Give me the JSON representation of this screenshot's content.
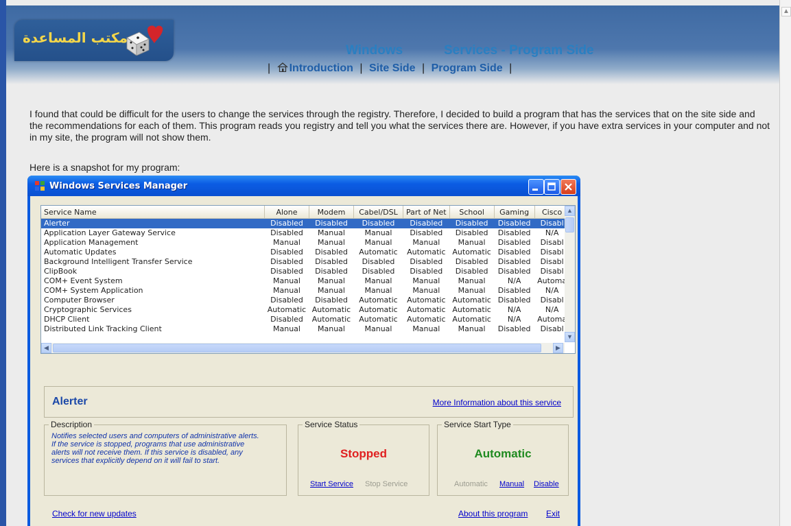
{
  "header": {
    "title_part1": "Windows",
    "title_part2": "Services - Program Side",
    "logo_text": "مكتب المساعدة"
  },
  "nav": {
    "items": [
      {
        "label": "Introduction",
        "icon": "home-icon"
      },
      {
        "label": "Site Side"
      },
      {
        "label": "Program Side"
      }
    ],
    "separator": "|"
  },
  "content": {
    "paragraph": "I found that could be difficult for the users to change the services through the registry. Therefore, I decided to build a program that has the services that on the site side and the recommendations for each of them. This program reads you registry and tell you what the services there are. However, if you have extra services in your computer and not in my site, the program will not show them.",
    "snapshot_caption": "Here is a snapshot for my program:"
  },
  "window": {
    "title": "Windows Services Manager",
    "columns": [
      "Service Name",
      "Alone",
      "Modem",
      "Cabel/DSL",
      "Part of Net",
      "School",
      "Gaming",
      "Cisco"
    ],
    "rows": [
      [
        "Alerter",
        "Disabled",
        "Disabled",
        "Disabled",
        "Disabled",
        "Disabled",
        "Disabled",
        "Disabl"
      ],
      [
        "Application Layer Gateway Service",
        "Disabled",
        "Manual",
        "Manual",
        "Disabled",
        "Disabled",
        "Disabled",
        "N/A"
      ],
      [
        "Application Management",
        "Manual",
        "Manual",
        "Manual",
        "Manual",
        "Manual",
        "Disabled",
        "Disabl"
      ],
      [
        "Automatic Updates",
        "Disabled",
        "Disabled",
        "Automatic",
        "Automatic",
        "Automatic",
        "Disabled",
        "Disabl"
      ],
      [
        "Background Intelligent Transfer Service",
        "Disabled",
        "Disabled",
        "Disabled",
        "Disabled",
        "Disabled",
        "Disabled",
        "Disabl"
      ],
      [
        "ClipBook",
        "Disabled",
        "Disabled",
        "Disabled",
        "Disabled",
        "Disabled",
        "Disabled",
        "Disabl"
      ],
      [
        "COM+ Event System",
        "Manual",
        "Manual",
        "Manual",
        "Manual",
        "Manual",
        "N/A",
        "Automa"
      ],
      [
        "COM+ System Application",
        "Manual",
        "Manual",
        "Manual",
        "Manual",
        "Manual",
        "Disabled",
        "N/A"
      ],
      [
        "Computer Browser",
        "Disabled",
        "Disabled",
        "Automatic",
        "Automatic",
        "Automatic",
        "Disabled",
        "Disabl"
      ],
      [
        "Cryptographic Services",
        "Automatic",
        "Automatic",
        "Automatic",
        "Automatic",
        "Automatic",
        "N/A",
        "N/A"
      ],
      [
        "DHCP Client",
        "Disabled",
        "Automatic",
        "Automatic",
        "Automatic",
        "Automatic",
        "N/A",
        "Automa"
      ],
      [
        "Distributed Link Tracking Client",
        "Manual",
        "Manual",
        "Manual",
        "Manual",
        "Manual",
        "Disabled",
        "Disabl"
      ]
    ],
    "selected": {
      "name": "Alerter",
      "more_info_link": "More Information about this service"
    },
    "description": {
      "legend": "Description",
      "text": "Notifies selected users and computers of administrative alerts. If the service is stopped, programs that use administrative alerts will not receive them. If this service is disabled, any services that explicitly depend on it will fail to start."
    },
    "status": {
      "legend": "Service Status",
      "value": "Stopped",
      "start_link": "Start Service",
      "stop_link": "Stop Service"
    },
    "start_type": {
      "legend": "Service Start Type",
      "value": "Automatic",
      "automatic_link": "Automatic",
      "manual_link": "Manual",
      "disable_link": "Disable"
    },
    "footer": {
      "updates": "Check for new updates",
      "about": "About this program",
      "exit": "Exit"
    }
  },
  "colors": {
    "status_stopped": "#e02020",
    "start_type_value": "#1f8a1f",
    "link": "#0000cc",
    "selection": "#316ac5",
    "title_blue": "#2a7fc1"
  }
}
